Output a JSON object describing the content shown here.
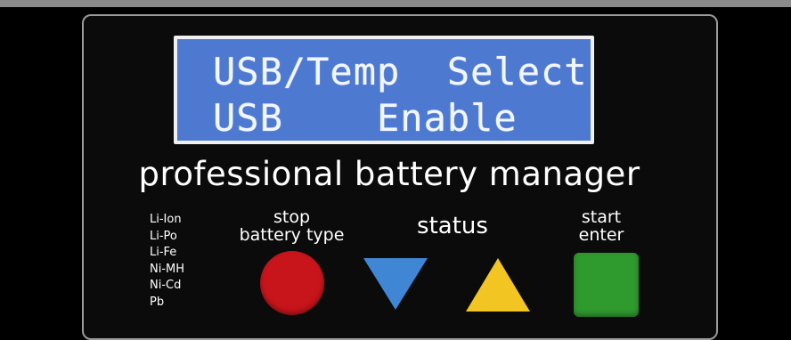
{
  "lcd": {
    "line1": "USB/Temp  Select",
    "line2": "USB    Enable"
  },
  "title": "professional battery manager",
  "battery_types": [
    "Li-Ion",
    "Li-Po",
    "Li-Fe",
    "Ni-MH",
    "Ni-Cd",
    "Pb"
  ],
  "buttons": {
    "stop_label_1": "stop",
    "stop_label_2": "battery type",
    "status_label": "status",
    "start_label_1": "start",
    "start_label_2": "enter"
  },
  "colors": {
    "lcd_bg": "#4e79d1",
    "stop": "#c8151b",
    "down": "#3f86d4",
    "up": "#f2c523",
    "start": "#2f9a2e"
  },
  "icons": {
    "stop": "circle-button",
    "down": "triangle-down",
    "up": "triangle-up",
    "start": "square-button"
  }
}
